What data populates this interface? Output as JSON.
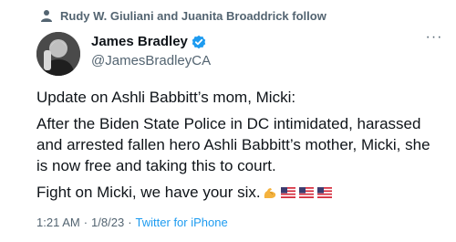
{
  "social_context": {
    "text": "Rudy W. Giuliani and Juanita Broaddrick follow",
    "icon": "person-icon"
  },
  "author": {
    "display_name": "James Bradley",
    "handle": "@JamesBradleyCA",
    "verified": true,
    "avatar_icon": "avatar-photo"
  },
  "tweet": {
    "lines": [
      "Update on Ashli Babbitt’s mom, Micki:",
      "After the Biden State Police in DC intimidated, harassed and arrested fallen hero Ashli Babbitt’s mother, Micki, she is now free and taking this to court.",
      "Fight on Micki, we have your six."
    ],
    "emojis": [
      "flexed-biceps-emoji",
      "us-flag-emoji",
      "us-flag-emoji",
      "us-flag-emoji"
    ]
  },
  "meta": {
    "time": "1:21 AM",
    "separator": "·",
    "date": "1/8/23",
    "source": "Twitter for iPhone"
  },
  "colors": {
    "text_primary": "#0f1419",
    "text_secondary": "#536471",
    "link": "#1d9bf0",
    "verified": "#1d9bf0"
  }
}
